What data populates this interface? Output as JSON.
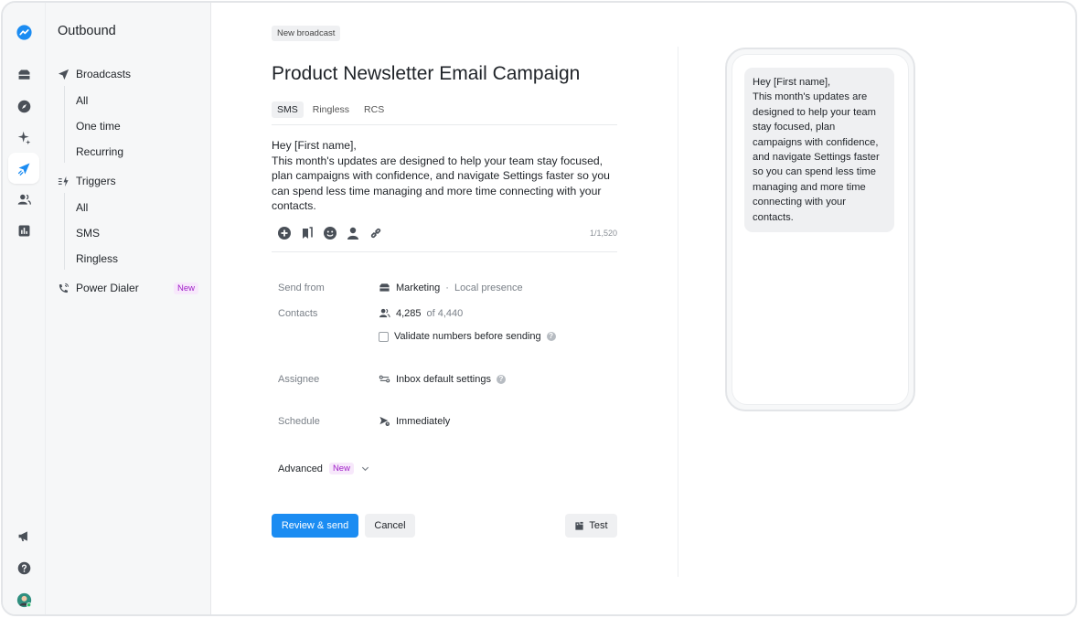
{
  "rail": {
    "items": [
      {
        "name": "inbox-icon"
      },
      {
        "name": "explore-icon"
      },
      {
        "name": "ai-sparkle-icon"
      },
      {
        "name": "outbound-icon",
        "active": true
      },
      {
        "name": "contacts-icon"
      },
      {
        "name": "reports-icon"
      }
    ],
    "bottom": [
      {
        "name": "announcements-icon"
      },
      {
        "name": "help-icon"
      },
      {
        "name": "user-avatar"
      }
    ]
  },
  "sidebar": {
    "title": "Outbound",
    "broadcasts": {
      "label": "Broadcasts",
      "items": [
        "All",
        "One time",
        "Recurring"
      ]
    },
    "triggers": {
      "label": "Triggers",
      "items": [
        "All",
        "SMS",
        "Ringless"
      ]
    },
    "power_dialer": {
      "label": "Power Dialer",
      "badge": "New"
    }
  },
  "main": {
    "chip": "New broadcast",
    "title": "Product Newsletter Email Campaign",
    "tabs": [
      "SMS",
      "Ringless",
      "RCS"
    ],
    "active_tab": "SMS",
    "message": "Hey [First name],\nThis month's updates are designed to help your team stay focused, plan campaigns with confidence, and navigate Settings faster so you can spend less time managing and more time connecting with your contacts.",
    "toolbar_icons": [
      "add-icon",
      "bookmark-icon",
      "emoji-icon",
      "person-icon",
      "link-icon"
    ],
    "char_counter": "1/1,520",
    "fields": {
      "send_from": {
        "label": "Send from",
        "value": "Marketing",
        "separator": "·",
        "sub": "Local presence"
      },
      "contacts": {
        "label": "Contacts",
        "count": "4,285",
        "of": "of 4,440",
        "validate_label": "Validate numbers before sending",
        "validate_checked": false
      },
      "assignee": {
        "label": "Assignee",
        "value": "Inbox default settings"
      },
      "schedule": {
        "label": "Schedule",
        "value": "Immediately"
      }
    },
    "advanced": {
      "label": "Advanced",
      "badge": "New"
    },
    "buttons": {
      "review": "Review & send",
      "cancel": "Cancel",
      "test": "Test"
    }
  },
  "preview": {
    "bubble": "Hey [First name],\nThis month's updates are designed to help your team stay focused, plan campaigns with confidence, and navigate Settings faster so you can spend less time managing and more time connecting with your contacts."
  },
  "colors": {
    "accent": "#1b8cf2",
    "badge_text": "#a020c8",
    "badge_bg": "#f7e8fb"
  }
}
